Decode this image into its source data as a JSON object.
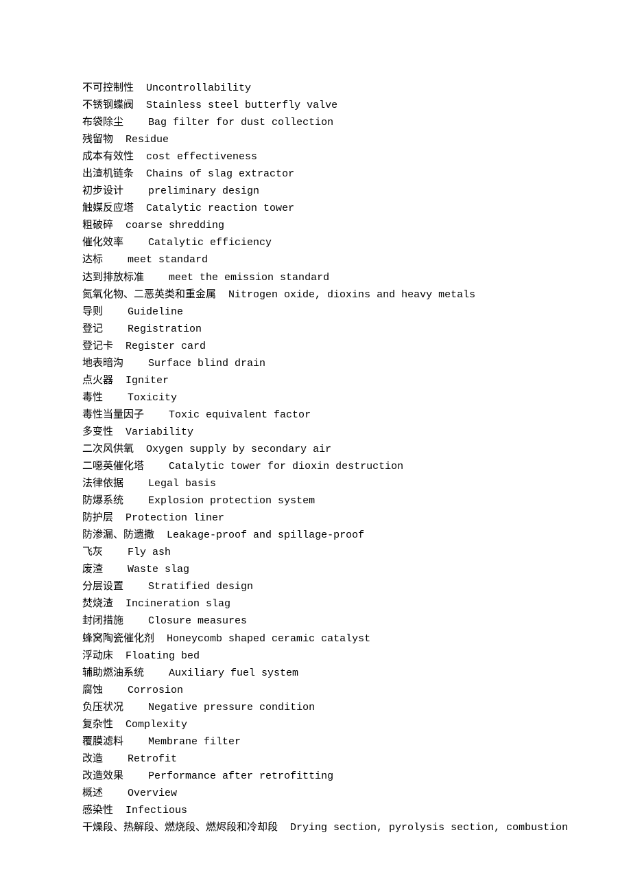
{
  "entries": [
    {
      "cn": "不可控制性",
      "gap": "  ",
      "en": "Uncontrollability"
    },
    {
      "cn": "不锈钢蝶阀",
      "gap": "  ",
      "en": "Stainless steel butterfly valve"
    },
    {
      "cn": "布袋除尘",
      "gap": "    ",
      "en": "Bag filter for dust collection"
    },
    {
      "cn": "残留物",
      "gap": "  ",
      "en": "Residue"
    },
    {
      "cn": "成本有效性",
      "gap": "  ",
      "en": "cost effectiveness"
    },
    {
      "cn": "出渣机链条",
      "gap": "  ",
      "en": "Chains of slag extractor"
    },
    {
      "cn": "初步设计",
      "gap": "    ",
      "en": "preliminary design"
    },
    {
      "cn": "触媒反应塔",
      "gap": "  ",
      "en": "Catalytic reaction tower"
    },
    {
      "cn": "粗破碎",
      "gap": "  ",
      "en": "coarse shredding"
    },
    {
      "cn": "催化效率",
      "gap": "    ",
      "en": "Catalytic efficiency"
    },
    {
      "cn": "达标",
      "gap": "    ",
      "en": "meet standard"
    },
    {
      "cn": "达到排放标准",
      "gap": "    ",
      "en": "meet the emission standard"
    },
    {
      "cn": "氮氧化物、二恶英类和重金属",
      "gap": "  ",
      "en": "Nitrogen oxide, dioxins and heavy metals"
    },
    {
      "cn": "导则",
      "gap": "    ",
      "en": "Guideline"
    },
    {
      "cn": "登记",
      "gap": "    ",
      "en": "Registration"
    },
    {
      "cn": "登记卡",
      "gap": "  ",
      "en": "Register card"
    },
    {
      "cn": "地表暗沟",
      "gap": "    ",
      "en": "Surface blind drain"
    },
    {
      "cn": "点火器",
      "gap": "  ",
      "en": "Igniter"
    },
    {
      "cn": "毒性",
      "gap": "    ",
      "en": "Toxicity"
    },
    {
      "cn": "毒性当量因子",
      "gap": "    ",
      "en": "Toxic equivalent factor"
    },
    {
      "cn": "多变性",
      "gap": "  ",
      "en": "Variability"
    },
    {
      "cn": "二次风供氧",
      "gap": "  ",
      "en": "Oxygen supply by secondary air"
    },
    {
      "cn": "二噁英催化塔",
      "gap": "    ",
      "en": "Catalytic tower for dioxin destruction"
    },
    {
      "cn": "法律依据",
      "gap": "    ",
      "en": "Legal basis"
    },
    {
      "cn": "防爆系统",
      "gap": "    ",
      "en": "Explosion protection system"
    },
    {
      "cn": "防护层",
      "gap": "  ",
      "en": "Protection liner"
    },
    {
      "cn": "防渗漏、防遗撒",
      "gap": "  ",
      "en": "Leakage-proof and spillage-proof"
    },
    {
      "cn": "飞灰",
      "gap": "    ",
      "en": "Fly ash"
    },
    {
      "cn": "废渣",
      "gap": "    ",
      "en": "Waste slag"
    },
    {
      "cn": "分层设置",
      "gap": "    ",
      "en": "Stratified design"
    },
    {
      "cn": "焚烧渣",
      "gap": "  ",
      "en": "Incineration slag"
    },
    {
      "cn": "封闭措施",
      "gap": "    ",
      "en": "Closure measures"
    },
    {
      "cn": "蜂窝陶瓷催化剂",
      "gap": "  ",
      "en": "Honeycomb shaped ceramic catalyst"
    },
    {
      "cn": "浮动床",
      "gap": "  ",
      "en": "Floating bed"
    },
    {
      "cn": "辅助燃油系统",
      "gap": "    ",
      "en": "Auxiliary fuel system"
    },
    {
      "cn": "腐蚀",
      "gap": "    ",
      "en": "Corrosion"
    },
    {
      "cn": "负压状况",
      "gap": "    ",
      "en": "Negative pressure condition"
    },
    {
      "cn": "复杂性",
      "gap": "  ",
      "en": "Complexity"
    },
    {
      "cn": "覆膜滤料",
      "gap": "    ",
      "en": "Membrane filter"
    },
    {
      "cn": "改造",
      "gap": "    ",
      "en": "Retrofit"
    },
    {
      "cn": "改造效果",
      "gap": "    ",
      "en": "Performance after retrofitting"
    },
    {
      "cn": "概述",
      "gap": "    ",
      "en": "Overview"
    },
    {
      "cn": "感染性",
      "gap": "  ",
      "en": "Infectious"
    },
    {
      "cn": "干燥段、热解段、燃烧段、燃烬段和冷却段",
      "gap": "  ",
      "en": "Drying section, pyrolysis section, combustion"
    }
  ]
}
